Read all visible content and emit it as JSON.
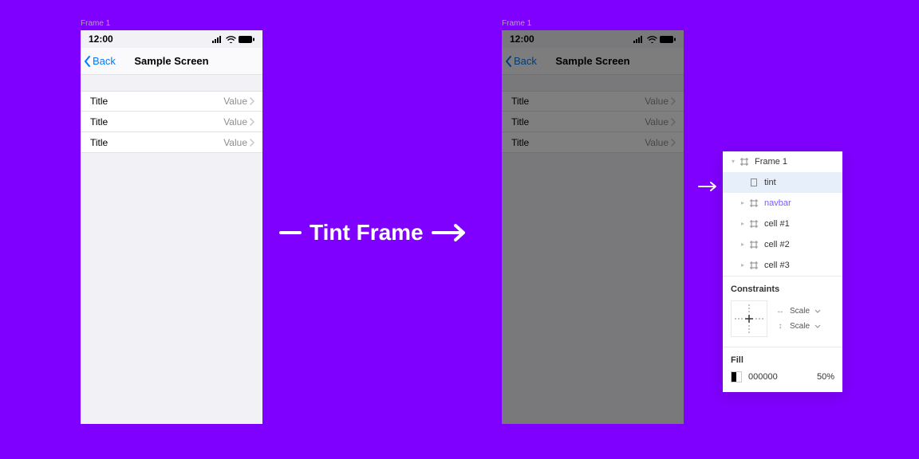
{
  "frame_label": "Frame 1",
  "phone": {
    "time": "12:00",
    "back_label": "Back",
    "title": "Sample Screen",
    "rows": [
      {
        "title": "Title",
        "value": "Value"
      },
      {
        "title": "Title",
        "value": "Value"
      },
      {
        "title": "Title",
        "value": "Value"
      }
    ]
  },
  "center_label": "Tint Frame",
  "panel": {
    "layers": {
      "root": "Frame 1",
      "tint": "tint",
      "navbar": "navbar",
      "cell1": "cell #1",
      "cell2": "cell #2",
      "cell3": "cell #3"
    },
    "constraints": {
      "title": "Constraints",
      "h": "Scale",
      "v": "Scale"
    },
    "fill": {
      "title": "Fill",
      "hex": "000000",
      "opacity": "50%"
    }
  }
}
